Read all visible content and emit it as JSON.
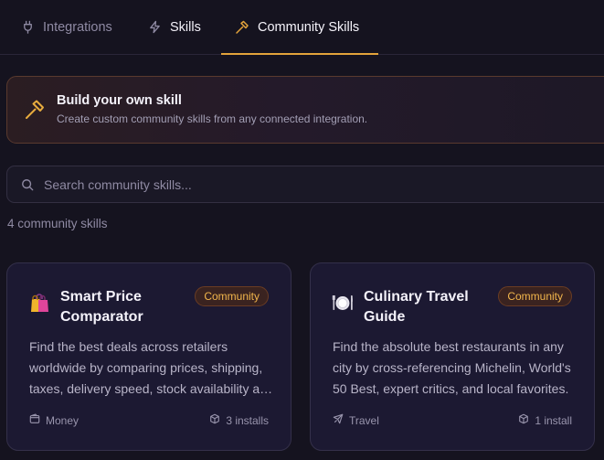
{
  "tabs": [
    {
      "label": "Integrations",
      "icon": "plug-icon",
      "active": false
    },
    {
      "label": "Skills",
      "icon": "lightning-icon",
      "active": false
    },
    {
      "label": "Community Skills",
      "icon": "hammer-icon",
      "active": true
    }
  ],
  "banner": {
    "icon": "hammer-icon",
    "title": "Build your own skill",
    "subtitle": "Create custom community skills from any connected integration."
  },
  "search": {
    "placeholder": "Search community skills...",
    "value": ""
  },
  "count_label": "4 community skills",
  "cards": [
    {
      "emoji": "shopping-bags-icon",
      "title": "Smart Price Comparator",
      "badge": "Community",
      "description": "Find the best deals across retailers worldwide by comparing prices, shipping, taxes, delivery speed, stock availability and more.",
      "category": "Money",
      "category_icon": "wallet-icon",
      "installs": "3 installs"
    },
    {
      "emoji": "plate-cutlery-icon",
      "title": "Culinary Travel Guide",
      "badge": "Community",
      "description": "Find the absolute best restaurants in any city by cross-referencing Michelin, World's 50 Best, expert critics, and local favorites.",
      "category": "Travel",
      "category_icon": "airplane-icon",
      "installs": "1 install"
    }
  ],
  "colors": {
    "background": "#15131f",
    "accent": "#e3a33b",
    "badge_text": "#f2b64c",
    "card_bg": "#1c1932"
  }
}
